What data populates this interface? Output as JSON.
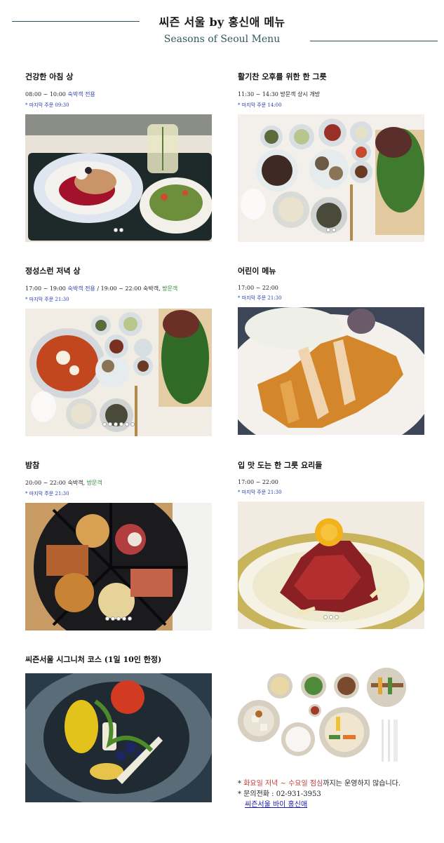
{
  "header": {
    "title": "씨즌 서울 by 홍신애 메뉴",
    "subtitle": "Seasons of Seoul Menu"
  },
  "menus": [
    {
      "title": "건강한 아침 상",
      "time": "08:00 ~ 10:00 ",
      "time_guest": "숙박객 전용",
      "time_rest": "",
      "last_order": "* 마지막 주문 09:30",
      "slides": 2,
      "active_slide": 1
    },
    {
      "title": "활기찬 오후를 위한 한 그릇",
      "time": "11:30 ~ 14:30 방문객 상시 개방",
      "time_guest": "",
      "time_rest": "",
      "last_order": "* 마지막 주문 14:00",
      "slides": 2,
      "active_slide": 1
    },
    {
      "title": "정성스런 저녁 상",
      "time": "17:00 ~ 19:00 ",
      "time_guest": "숙박객 전용",
      "time_mid": " / 19:00 ~ 22:00 숙박객, ",
      "time_visitor": "방문객",
      "last_order": "* 마지막 주문 21:30",
      "slides": 6,
      "active_slide": 2
    },
    {
      "title": "어린이 메뉴",
      "time": "17:00 ~ 22:00",
      "last_order": "* 마지막 주문 21:30",
      "slides": 0,
      "active_slide": 0
    },
    {
      "title": "밤참",
      "time": "20:00 ~ 22:00 숙박객, ",
      "time_visitor": "방문객",
      "last_order": "* 마지막 주문 21:30",
      "slides": 5,
      "active_slide": 0
    },
    {
      "title": "입 맛 도는 한 그릇 요리들",
      "time": "17:00 ~ 22:00",
      "last_order": "* 마지막 주문 21:30",
      "slides": 3,
      "active_slide": 0
    },
    {
      "title": "씨즌서울 시그니처 코스 (1일 10인 한정)"
    }
  ],
  "notes": {
    "closed_prefix": "* ",
    "closed_red": "화요일 저녁 ~ 수요일 점심",
    "closed_rest": "까지는 운영하지 않습니다.",
    "phone": "* 문의전화 : 02-931-3953",
    "link": "씨즌서울 바이 홍신애"
  },
  "colors": {
    "header_line": "#2f4f5a",
    "subtitle": "#2e5a5a",
    "guest_text": "#2f3fae",
    "visitor_text": "#2c8a3a",
    "closed_text": "#c23a3a",
    "link": "#1a1aa6"
  }
}
